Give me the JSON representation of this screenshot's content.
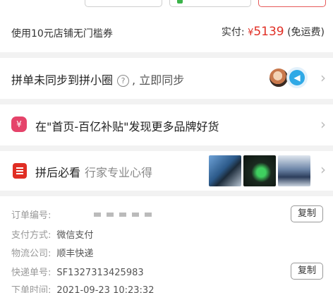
{
  "summary": {
    "coupon_text": "使用10元店铺无门槛券",
    "paid_label": "实付:",
    "currency": "¥",
    "amount": "5139",
    "shipping": "(免运费)"
  },
  "group_sync": {
    "text": "拼单未同步到拼小圈",
    "help_icon": "?",
    "action": ", 立即同步"
  },
  "promo": {
    "icon": "¥",
    "text": "在\"首页-百亿补贴\"发现更多品牌好货"
  },
  "reviews": {
    "title": "拼后必看",
    "subtitle": "行家专业心得"
  },
  "order_info": {
    "order_no_label": "订单编号:",
    "payment_label": "支付方式:",
    "payment_value": "微信支付",
    "logistics_label": "物流公司:",
    "logistics_value": "顺丰快递",
    "tracking_label": "快递单号:",
    "tracking_value": "SF1327313425983",
    "time_label": "下单时间:",
    "time_value": "2021-09-23 10:23:32",
    "copy_label": "复制"
  },
  "colors": {
    "accent_red": "#e02e24",
    "page_bg": "#f2f2f2"
  },
  "icons": {
    "chevron": "chevron-right-icon",
    "promo": "shopping-bag-icon",
    "reviews": "document-icon"
  }
}
